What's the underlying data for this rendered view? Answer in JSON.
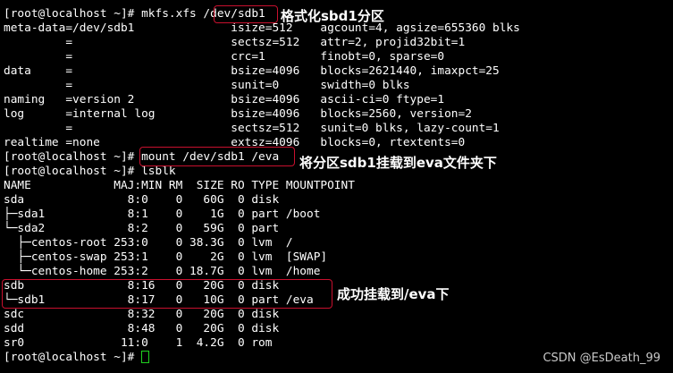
{
  "terminal": {
    "lines": [
      "[root@localhost ~]# mkfs.xfs /dev/sdb1",
      "meta-data=/dev/sdb1              isize=512    agcount=4, agsize=655360 blks",
      "         =                       sectsz=512   attr=2, projid32bit=1",
      "         =                       crc=1        finobt=0, sparse=0",
      "data     =                       bsize=4096   blocks=2621440, imaxpct=25",
      "         =                       sunit=0      swidth=0 blks",
      "naming   =version 2              bsize=4096   ascii-ci=0 ftype=1",
      "log      =internal log           bsize=4096   blocks=2560, version=2",
      "         =                       sectsz=512   sunit=0 blks, lazy-count=1",
      "realtime =none                   extsz=4096   blocks=0, rtextents=0",
      "[root@localhost ~]# mount /dev/sdb1 /eva",
      "[root@localhost ~]# lsblk",
      "NAME            MAJ:MIN RM  SIZE RO TYPE MOUNTPOINT",
      "sda               8:0    0   60G  0 disk",
      "├─sda1            8:1    0    1G  0 part /boot",
      "└─sda2            8:2    0   59G  0 part",
      "  ├─centos-root 253:0    0 38.3G  0 lvm  /",
      "  ├─centos-swap 253:1    0    2G  0 lvm  [SWAP]",
      "  └─centos-home 253:2    0 18.7G  0 lvm  /home",
      "sdb               8:16   0   20G  0 disk",
      "└─sdb1            8:17   0   10G  0 part /eva",
      "sdc               8:32   0   20G  0 disk",
      "sdd               8:48   0   20G  0 disk",
      "sr0              11:0    1  4.2G  0 rom",
      "[root@localhost ~]# "
    ]
  },
  "annotations": {
    "format": "格式化sbd1分区",
    "mount": "将分区sdb1挂载到eva文件夹下",
    "success": "成功挂载到/eva下"
  },
  "watermark": "CSDN @EsDeath_99",
  "colors": {
    "background": "#000000",
    "text": "#ffffff",
    "highlight_box": "#c8102e",
    "cursor": "#1fd11f"
  }
}
